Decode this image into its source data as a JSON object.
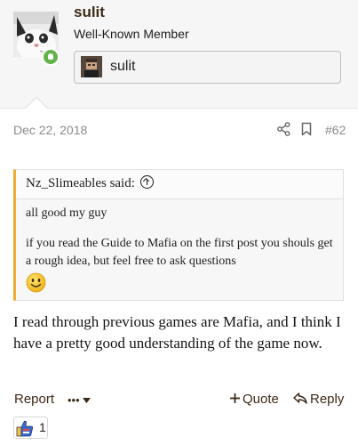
{
  "user": {
    "name": "sulit",
    "title": "Well-Known Member",
    "banner_name": "sulit",
    "status_icon": "online-person-icon",
    "status_color": "#63b34a"
  },
  "post": {
    "date": "Dec 22, 2018",
    "number": "#62",
    "body": "I read through previous games are Mafia, and I think I have a pretty good understanding of the game now."
  },
  "quote": {
    "author_said": "Nz_Slimeables said:",
    "line1": "all good my guy",
    "line2": "if you read the Guide to Mafia on the first post you shouls get a rough idea, but feel free to ask questions",
    "emoji": "smiley-face-icon",
    "accent_color": "#f0ab35"
  },
  "actions": {
    "report": "Report",
    "more": "•••",
    "quote": "Quote",
    "reply": "Reply"
  },
  "reactions": {
    "icon": "like-icon",
    "count": "1"
  }
}
